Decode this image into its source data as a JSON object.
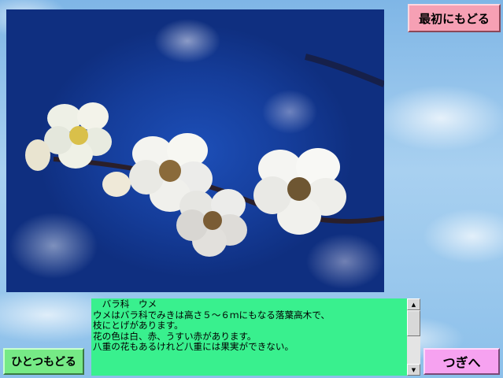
{
  "buttons": {
    "start_over": "最初にもどる",
    "back": "ひとつもどる",
    "next": "つぎへ"
  },
  "description": {
    "lines": [
      "　バラ科　ウメ",
      "",
      "ウメはバラ科でみきは高さ５～６ｍにもなる落葉高木で、",
      "枝にとげがあります。",
      "花の色は白、赤、うすい赤があります。",
      "八重の花もあるけれど八重には果実ができない。"
    ]
  },
  "scrollbar": {
    "up_arrow": "▲",
    "down_arrow": "▼"
  },
  "colors": {
    "start_button": "#f6a0b4",
    "back_button": "#76ea86",
    "next_button": "#f6a2f0",
    "text_panel": "#39f08e"
  }
}
